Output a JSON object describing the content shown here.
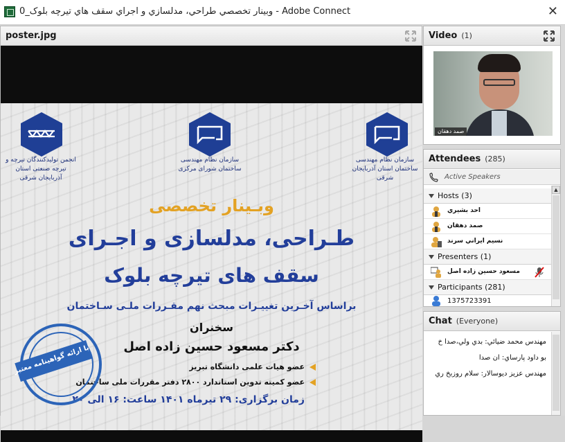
{
  "window": {
    "title": "وبينار تخصصي طراحي، مدلسازي و اجراي سقف هاي تيرچه بلوک_0 - Adobe Connect",
    "close_glyph": "✕"
  },
  "share_pod": {
    "title": "poster.jpg",
    "poster": {
      "left_org": "انجمن تولیدکنندگان تیرچه و تیرچه صنعتی استان آذربایجان شرقی",
      "center_org": "سازمان نظام مهندسی ساختمان شورای مرکزی",
      "right_org": "سازمان نظام مهندسی ساختمان استان آذربایجان شرقی",
      "webinar": "وبـینار تخصصی",
      "headline_1": "طـراحی، مدلسازی و اجـرای",
      "headline_2": "سقف های تیرچه بلوک",
      "basis": "براساس آخـرین تغییـرات مبحث نهم مقـررات ملـی سـاختمان",
      "speakers_label": "سخنران",
      "speaker": "دکتر مسعود حسین زاده اصل",
      "member_1": "عضو هیات علمی دانشگاه تبریز",
      "member_2": "عضو کمیته تدوین استاندارد ۲۸۰۰ دفتر مقررات ملی ساختمان",
      "schedule": "زمان برگزاری: ۲۹ تیرماه ۱۴۰۱ ساعت: ۱۶ الی ۲۰",
      "stamp": "با ارائه گواهینامه معتبر"
    }
  },
  "video_pod": {
    "title": "Video",
    "count": "(1)",
    "name_tag": "صمد دهقان"
  },
  "attendees_pod": {
    "title": "Attendees",
    "count": "(285)",
    "active_speakers": "Active Speakers",
    "hosts_label": "Hosts (3)",
    "hosts": [
      "احد بشيري",
      "صمد دهقان",
      "نسيم ايراني سرند"
    ],
    "presenters_label": "Presenters (1)",
    "presenters": [
      "مسعود حسين زاده اصل"
    ],
    "participants_label": "Participants (281)",
    "participants": [
      "1375723391"
    ]
  },
  "chat_pod": {
    "title": "Chat",
    "scope": "(Everyone)",
    "messages": [
      "مهندس محمد ضيائي: بدي ولي،صدا خ",
      "بو داود پارساي: ان صدا",
      "مهندس عزيز ديوسالار: سلام روزبخ ري"
    ]
  },
  "colors": {
    "poster_blue": "#223e9a",
    "poster_gold": "#e3a224",
    "stamp_blue": "#2c64b8"
  }
}
